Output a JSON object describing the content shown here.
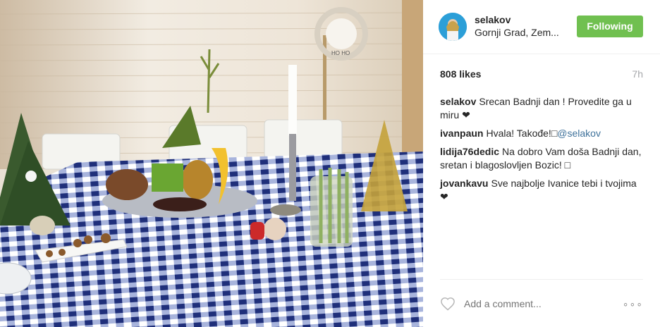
{
  "post": {
    "username": "selakov",
    "location": "Gornji Grad, Zem...",
    "follow_label": "Following",
    "likes": "808 likes",
    "time": "7h",
    "add_comment_placeholder": "Add a comment...",
    "more_label": "∘∘∘"
  },
  "comments": [
    {
      "user": "selakov",
      "text": "Srecan Badnji dan ! Provedite ga u miru ❤",
      "mention": ""
    },
    {
      "user": "ivanpaun",
      "text": "Hvala! Takođe!□",
      "mention": "@selakov"
    },
    {
      "user": "lidija76dedic",
      "text": "Na dobro Vam doša Badnji dan, sretan i blagoslovljen Bozic! □",
      "mention": ""
    },
    {
      "user": "jovankavu",
      "text": "Sve najbolje Ivanice tebi i tvojima ❤",
      "mention": ""
    }
  ],
  "colors": {
    "follow": "#70c050",
    "mention": "#3f729b",
    "muted": "#a5a7aa",
    "text": "#262626"
  },
  "icons": {
    "like": "heart-icon",
    "more": "more-options-icon"
  }
}
